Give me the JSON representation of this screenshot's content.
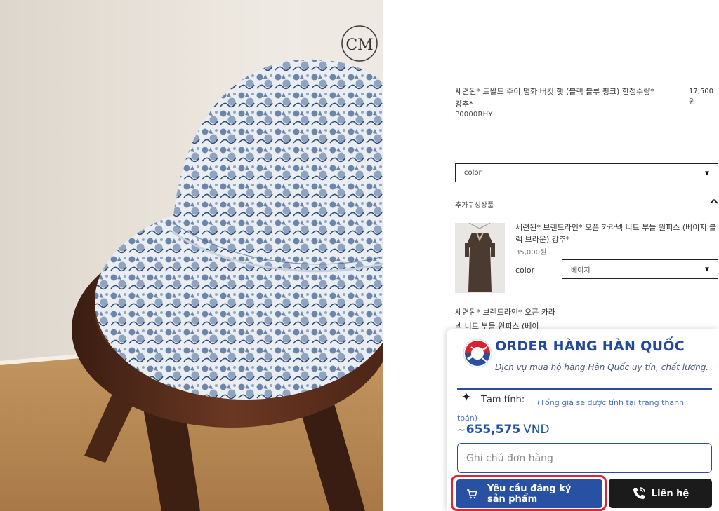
{
  "product": {
    "title": "세련된* 트왈드 주이 명화 버킷 햇 (블랙 블루 핑크) 한정수량* 강추*",
    "code": "P0000RHY",
    "price": "17,500원",
    "option_placeholder": "color",
    "image_monogram": "CM"
  },
  "addons": {
    "heading": "추가구성상품",
    "item": {
      "title": "세련된* 브랜드라인* 오픈 카라넥 니트 부들 원피스 (베이지 블랙 브라운) 강추*",
      "price": "35,000원",
      "option_label": "color",
      "option_value": "베이지"
    },
    "partial_text": "세련된* 브랜드라인* 오픈 카라넥 니트 부들 원피스 (베이"
  },
  "widget": {
    "brand": "ORDER HÀNG HÀN QUỐC",
    "tagline": "Dịch vụ mua hộ hàng Hàn Quốc uy tín, chất lượng.",
    "subtotal_label": "Tạm tính:",
    "subtotal_note": "(Tổng giá sẽ được tính tại trang thanh toán)",
    "total_prefix": "~",
    "total_amount": "655,575",
    "total_currency": "VND",
    "note_placeholder": "Ghi chú đơn hàng",
    "register_label": "Yêu cầu đăng ký sản phẩm",
    "contact_label": "Liên hệ",
    "accent_color": "#2851a3",
    "highlight_color": "#e0232e"
  }
}
